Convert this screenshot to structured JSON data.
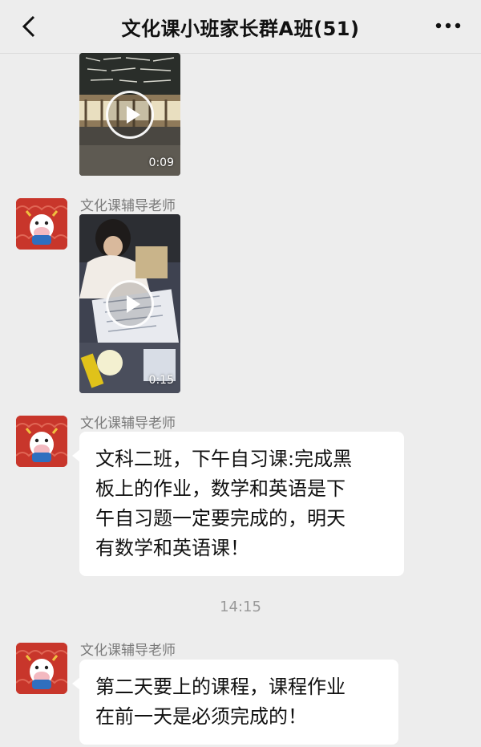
{
  "header": {
    "title": "文化课小班家长群A班(51)"
  },
  "messages": [
    {
      "type": "video",
      "duration": "0:09"
    },
    {
      "type": "video",
      "sender": "文化课辅导老师",
      "duration": "0:15"
    },
    {
      "type": "text",
      "sender": "文化课辅导老师",
      "lines": [
        "文科二班，下午自习课:完成黑",
        "板上的作业，数学和英语是下",
        "午自习题一定要完成的，明天",
        "有数学和英语课！"
      ]
    },
    {
      "type": "timestamp",
      "text": "14:15"
    },
    {
      "type": "text",
      "sender": "文化课辅导老师",
      "lines": [
        "第二天要上的课程，课程作业",
        "在前一天是必须完成的！"
      ]
    }
  ],
  "colors": {
    "background": "#ededed",
    "bubble": "#ffffff",
    "avatar": "#c8362b"
  },
  "icons": {
    "back": "chevron-left-icon",
    "more": "more-dots-icon",
    "play": "play-icon"
  }
}
